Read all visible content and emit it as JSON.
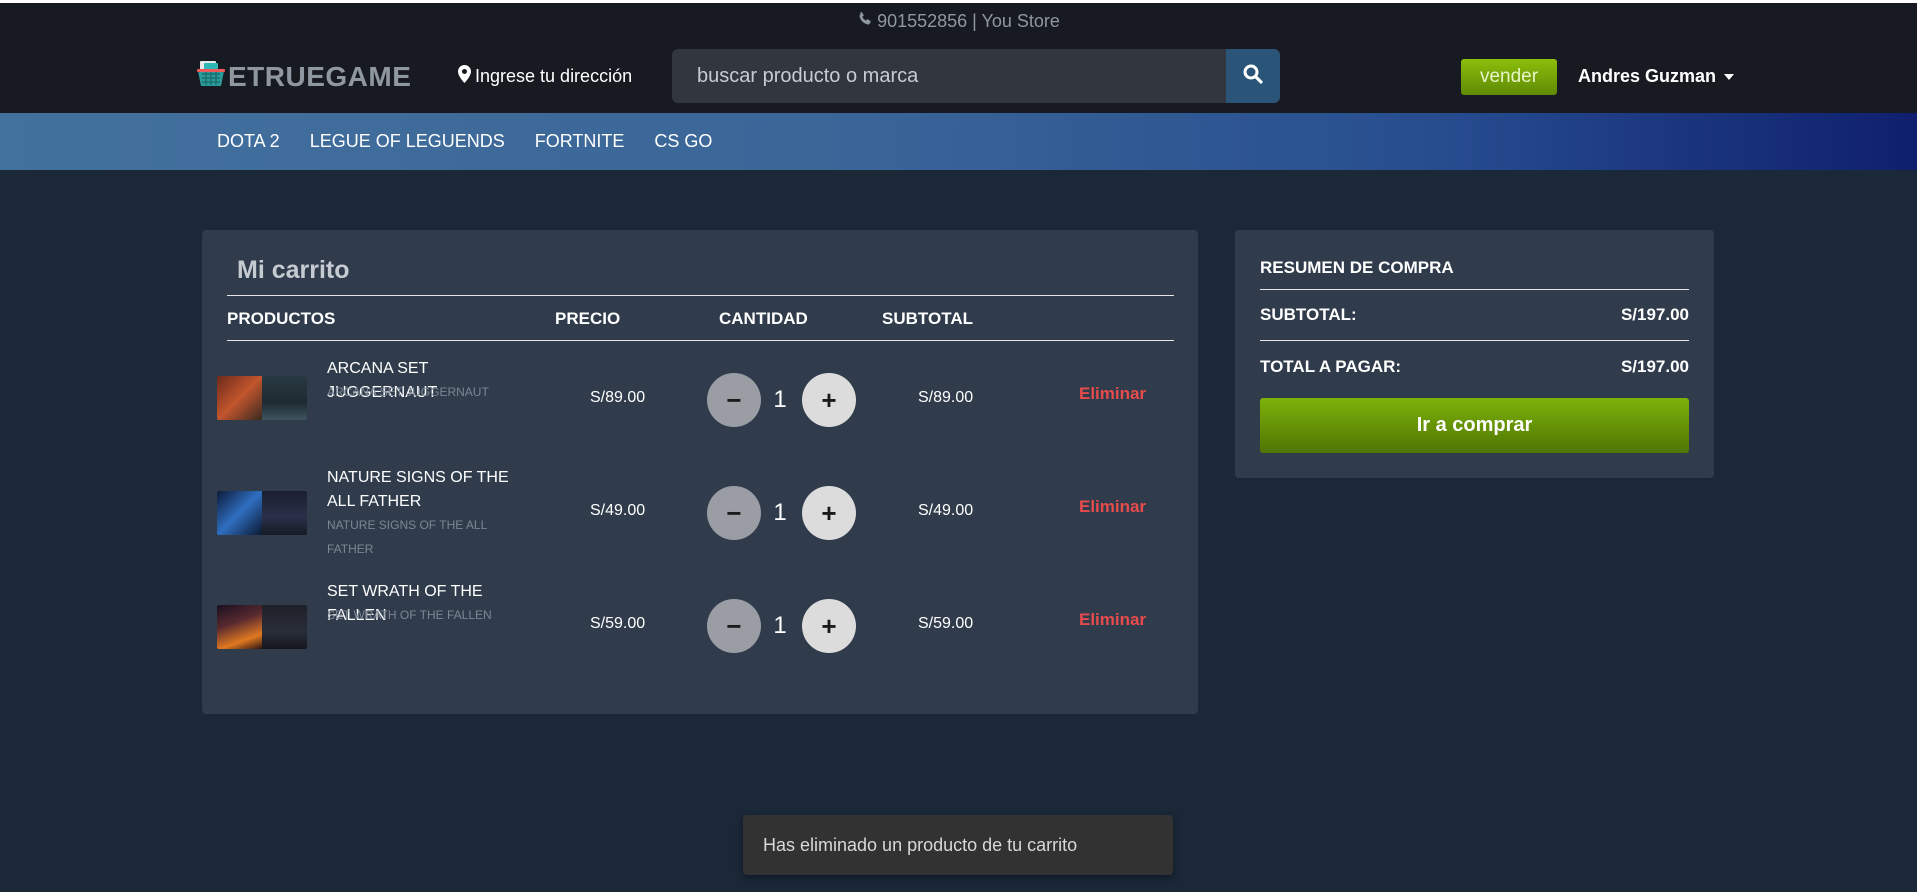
{
  "header": {
    "phone_text": "901552856 | You Store",
    "logo_text": "ETRUEGAME",
    "address_label": "Ingrese tu dirección",
    "search_placeholder": "buscar producto o marca",
    "sell_label": "vender",
    "user_name": "Andres Guzman"
  },
  "nav": {
    "items": [
      {
        "label": "DOTA 2"
      },
      {
        "label": "LEGUE OF LEGUENDS"
      },
      {
        "label": "FORTNITE"
      },
      {
        "label": "CS GO"
      }
    ]
  },
  "cart": {
    "title": "Mi carrito",
    "columns": {
      "products": "PRODUCTOS",
      "price": "PRECIO",
      "quantity": "CANTIDAD",
      "subtotal": "SUBTOTAL"
    },
    "items": [
      {
        "name": "ARCANA SET JUGGERNAUT",
        "subtitle": "ARCANA SET JUGGERNAUT",
        "price": "S/89.00",
        "quantity": "1",
        "subtotal": "S/89.00",
        "remove_label": "Eliminar"
      },
      {
        "name": "NATURE SIGNS OF THE ALL FATHER",
        "subtitle": "NATURE SIGNS OF THE ALL FATHER",
        "price": "S/49.00",
        "quantity": "1",
        "subtotal": "S/49.00",
        "remove_label": "Eliminar"
      },
      {
        "name": "SET WRATH OF THE FALLEN",
        "subtitle": "SET WRATH OF THE FALLEN",
        "price": "S/59.00",
        "quantity": "1",
        "subtotal": "S/59.00",
        "remove_label": "Eliminar"
      }
    ],
    "minus_symbol": "−",
    "plus_symbol": "+"
  },
  "summary": {
    "title": "RESUMEN DE COMPRA",
    "subtotal_label": "SUBTOTAL:",
    "subtotal_value": "S/197.00",
    "total_label": "TOTAL A PAGAR:",
    "total_value": "S/197.00",
    "buy_label": "Ir a comprar"
  },
  "toast": {
    "message": "Has eliminado un producto de tu carrito"
  },
  "colors": {
    "page_bg": "#1b2838",
    "topbar_bg": "#171a21",
    "panel_bg": "#303c4c",
    "accent_green": "#7db20a",
    "danger_red": "#e84b4b",
    "nav_blue": "#43719d"
  },
  "icons": [
    "phone-icon",
    "basket-icon",
    "location-pin-icon",
    "search-icon",
    "caret-down-icon"
  ]
}
